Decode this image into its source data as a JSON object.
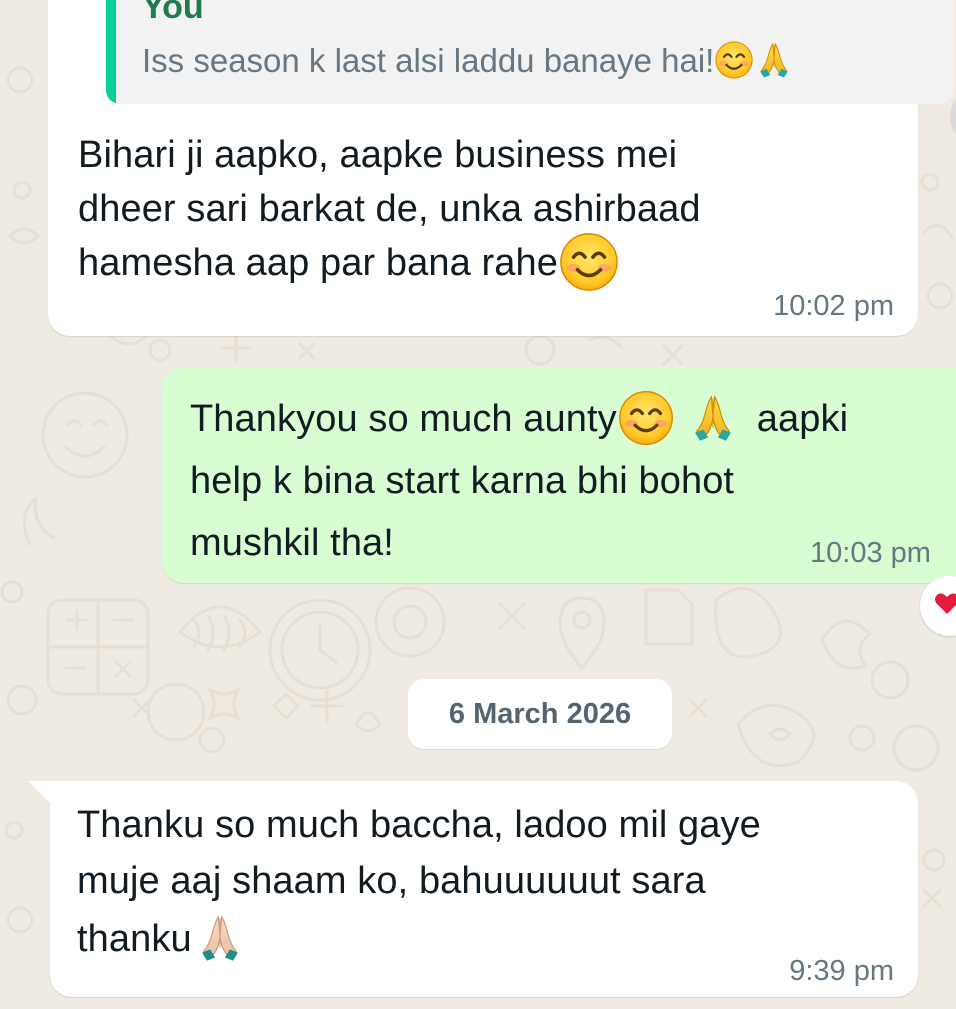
{
  "theme": {
    "chat_bg": "#efeae2",
    "incoming_bg": "#ffffff",
    "outgoing_bg": "#d9fdd3",
    "quote_bar": "#06cf9c",
    "quote_author": "#1f7a4e",
    "time_color": "#667781",
    "date_pill_text": "#54656f"
  },
  "messages": [
    {
      "direction": "incoming",
      "quote": {
        "author": "You",
        "text": "Iss season k last alsi laddu banaye hai!",
        "emojis": [
          "smiling-face-icon",
          "folded-hands-icon"
        ]
      },
      "lines": [
        "Bihari ji aapko, aapke business mei",
        "dheer sari barkat de, unka ashirbaad",
        "hamesha aap par bana rahe"
      ],
      "emoji": "smiling-face-icon",
      "time": "10:02 pm"
    },
    {
      "direction": "outgoing",
      "lines": [
        "Thankyou so much aunty",
        "aapki",
        "help k bina start karna bhi bohot",
        "mushkil tha!"
      ],
      "emojis": [
        "smiling-face-icon",
        "folded-hands-icon"
      ],
      "time": "10:03 pm",
      "reaction": "heart-icon"
    },
    {
      "direction": "incoming",
      "lines": [
        "Thanku so much baccha, ladoo mil gaye",
        "muje aaj shaam ko, bahuuuuuut sara",
        "thanku"
      ],
      "emoji": "folded-hands-light-skin-icon",
      "time": "9:39 pm"
    }
  ],
  "date_separator": "6 March 2026"
}
